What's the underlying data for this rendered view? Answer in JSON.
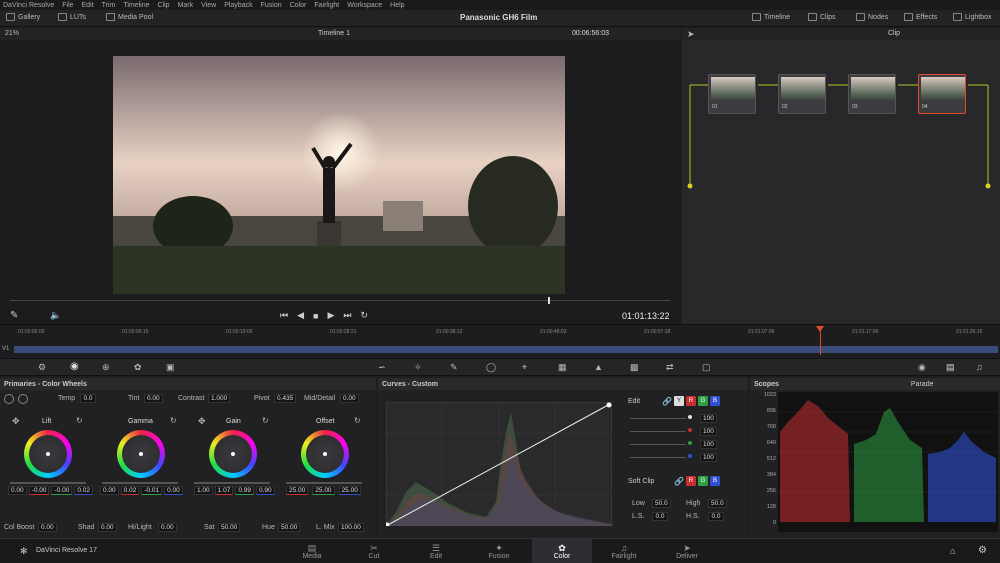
{
  "menubar": {
    "items": [
      "DaVinci Resolve",
      "File",
      "Edit",
      "Trim",
      "Timeline",
      "Clip",
      "Mark",
      "View",
      "Playback",
      "Fusion",
      "Color",
      "Fairlight",
      "Workspace",
      "Help"
    ]
  },
  "topbar": {
    "gallery": "Gallery",
    "luts": "LUTs",
    "media_pool": "Media Pool",
    "project_title": "Panasonic GH6 Film",
    "timeline": "Timeline",
    "clips": "Clips",
    "nodes": "Nodes",
    "effects": "Effects",
    "lightbox": "Lightbox"
  },
  "viewer": {
    "zoom": "21%",
    "timeline_name": "Timeline 1",
    "timecode_top": "00:06:56:03",
    "timecode": "01:01:13:22"
  },
  "nodegraph": {
    "mode": "Clip",
    "nodes": [
      {
        "label": "01"
      },
      {
        "label": "02"
      },
      {
        "label": "03"
      },
      {
        "label": "04"
      }
    ]
  },
  "timeline": {
    "track": "V1",
    "ticks": [
      "01:00:00:00",
      "01:00:09:15",
      "01:00:19:06",
      "01:00:28:21",
      "01:00:38:12",
      "01:00:48:03",
      "01:00:57:18",
      "01:01:07:09",
      "01:01:17:00",
      "01:01:26:15"
    ]
  },
  "wheels": {
    "title": "Primaries - Color Wheels",
    "temp_label": "Temp",
    "temp": "0.0",
    "tint_label": "Tint",
    "tint": "0.00",
    "contrast_label": "Contrast",
    "contrast": "1.000",
    "pivot_label": "Pivot",
    "pivot": "0.435",
    "middetail_label": "Mid/Detail",
    "middetail": "0.00",
    "lift": {
      "name": "Lift",
      "values": [
        "0.00",
        "-0.00",
        "-0.00",
        "0.02"
      ]
    },
    "gamma": {
      "name": "Gamma",
      "values": [
        "0.00",
        "0.02",
        "-0.01",
        "0.00"
      ]
    },
    "gain": {
      "name": "Gain",
      "values": [
        "1.00",
        "1.07",
        "0.99",
        "0.90"
      ]
    },
    "offset": {
      "name": "Offset",
      "values": [
        "25.00",
        "25.00",
        "25.00"
      ]
    },
    "colboost_label": "Col Boost",
    "colboost": "0.00",
    "shad_label": "Shad",
    "shad": "0.00",
    "hilight_label": "Hi/Light",
    "hilight": "0.00",
    "sat_label": "Sat",
    "sat": "50.00",
    "hue_label": "Hue",
    "hue": "50.00",
    "lmix_label": "L. Mix",
    "lmix": "100.00"
  },
  "curves": {
    "title": "Curves - Custom"
  },
  "curveedit": {
    "edit_label": "Edit",
    "channels": [
      "Y",
      "R",
      "G",
      "B"
    ],
    "intensities": [
      "100",
      "100",
      "100",
      "100"
    ],
    "softclip_label": "Soft Clip",
    "low_label": "Low",
    "low": "50.0",
    "high_label": "High",
    "high": "50.0",
    "ls_label": "L.S.",
    "ls": "0.0",
    "hs_label": "H.S.",
    "hs": "0.0"
  },
  "scopes": {
    "title": "Scopes",
    "mode": "Parade",
    "scale": [
      "1023",
      "896",
      "768",
      "640",
      "512",
      "384",
      "256",
      "128",
      "0"
    ]
  },
  "bottomnav": {
    "app": "DaVinci Resolve 17",
    "pages": [
      "Media",
      "Cut",
      "Edit",
      "Fusion",
      "Color",
      "Fairlight",
      "Deliver"
    ],
    "active": "Color"
  },
  "colors": {
    "accent": "#e24a2c",
    "red": "#c83030",
    "green": "#2ea043",
    "blue": "#3050d0"
  }
}
